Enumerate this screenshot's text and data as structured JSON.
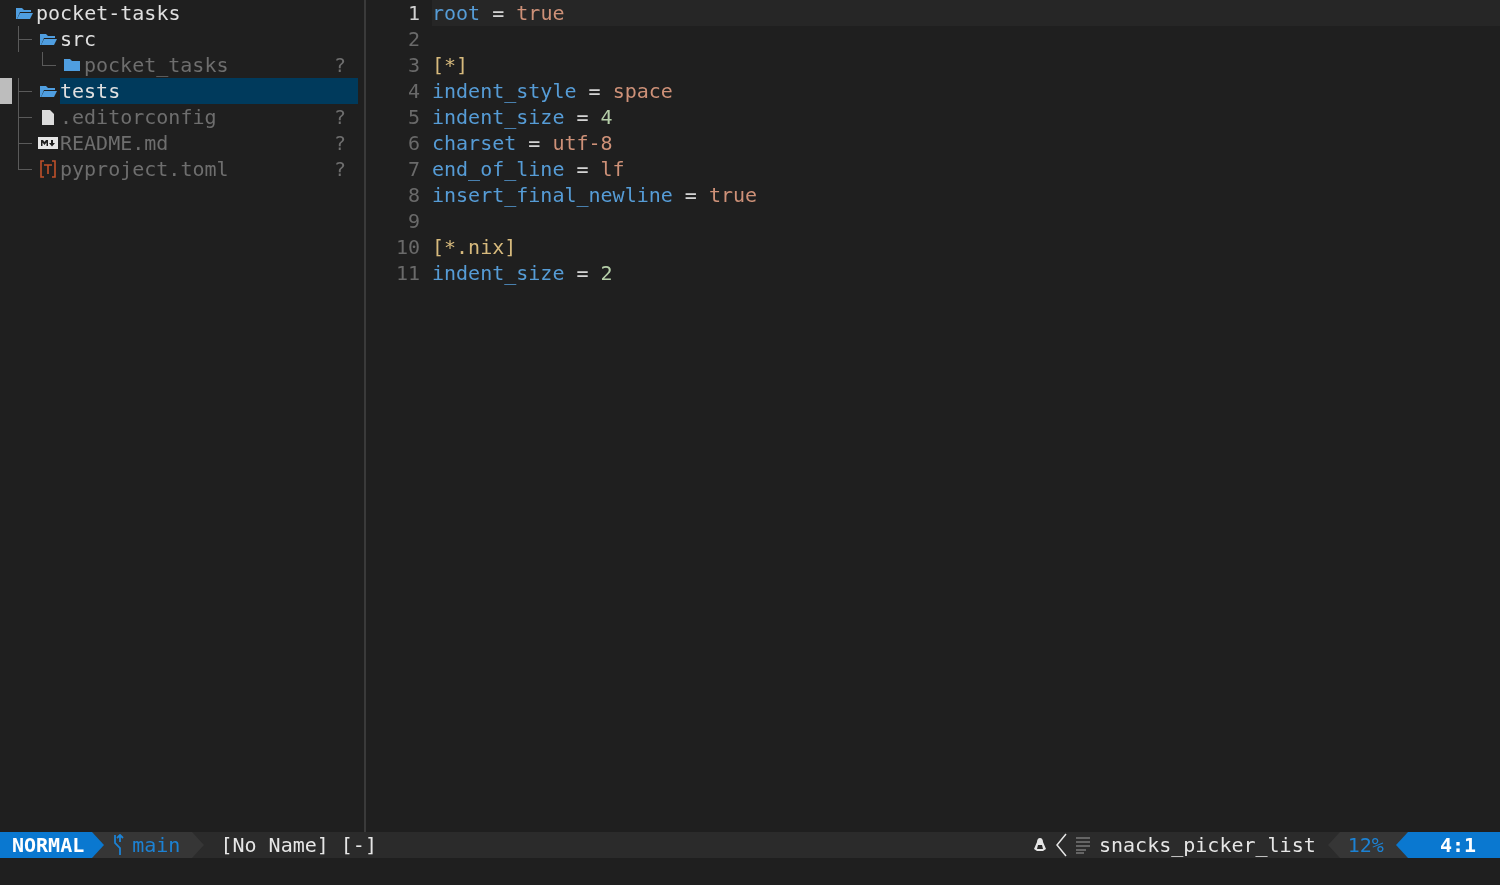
{
  "tree": [
    {
      "name": "pocket-tasks",
      "kind": "folder",
      "expanded": true,
      "dimmed": false,
      "selected": false,
      "children": [
        {
          "name": "src",
          "kind": "folder",
          "expanded": true,
          "dimmed": false,
          "selected": false,
          "children": [
            {
              "name": "pocket_tasks",
              "kind": "folder",
              "expanded": false,
              "dimmed": true,
              "selected": false,
              "status": "?"
            }
          ]
        },
        {
          "name": "tests",
          "kind": "folder",
          "expanded": true,
          "dimmed": false,
          "selected": true
        },
        {
          "name": ".editorconfig",
          "kind": "file",
          "dimmed": true,
          "selected": false,
          "status": "?"
        },
        {
          "name": "README.md",
          "kind": "markdown",
          "dimmed": true,
          "selected": false,
          "status": "?"
        },
        {
          "name": "pyproject.toml",
          "kind": "toml",
          "dimmed": true,
          "selected": false,
          "status": "?"
        }
      ]
    }
  ],
  "editor": {
    "lines": [
      {
        "number": "1",
        "current": true,
        "tokens": [
          {
            "kind": "key",
            "text": "root"
          },
          {
            "kind": "op",
            "text": " = "
          },
          {
            "kind": "string",
            "text": "true"
          }
        ]
      },
      {
        "number": "2",
        "current": false
      },
      {
        "number": "3",
        "current": false,
        "tokens": [
          {
            "kind": "section",
            "text": "[*]"
          }
        ]
      },
      {
        "number": "4",
        "current": false,
        "tokens": [
          {
            "kind": "key",
            "text": "indent_style"
          },
          {
            "kind": "op",
            "text": " = "
          },
          {
            "kind": "string",
            "text": "space"
          }
        ]
      },
      {
        "number": "5",
        "current": false,
        "tokens": [
          {
            "kind": "key",
            "text": "indent_size"
          },
          {
            "kind": "op",
            "text": " = "
          },
          {
            "kind": "number",
            "text": "4"
          }
        ]
      },
      {
        "number": "6",
        "current": false,
        "tokens": [
          {
            "kind": "key",
            "text": "charset"
          },
          {
            "kind": "op",
            "text": " = "
          },
          {
            "kind": "string",
            "text": "utf-8"
          }
        ]
      },
      {
        "number": "7",
        "current": false,
        "tokens": [
          {
            "kind": "key",
            "text": "end_of_line"
          },
          {
            "kind": "op",
            "text": " = "
          },
          {
            "kind": "string",
            "text": "lf"
          }
        ]
      },
      {
        "number": "8",
        "current": false,
        "tokens": [
          {
            "kind": "key",
            "text": "insert_final_newline"
          },
          {
            "kind": "op",
            "text": " = "
          },
          {
            "kind": "string",
            "text": "true"
          }
        ]
      },
      {
        "number": "9",
        "current": false
      },
      {
        "number": "10",
        "current": false,
        "tokens": [
          {
            "kind": "section",
            "text": "[*.nix]"
          }
        ]
      },
      {
        "number": "11",
        "current": false,
        "tokens": [
          {
            "kind": "key",
            "text": "indent_size"
          },
          {
            "kind": "op",
            "text": " = "
          },
          {
            "kind": "number",
            "text": "2"
          }
        ]
      }
    ]
  },
  "status_bar": {
    "mode": "NORMAL",
    "branch": "main",
    "buffer": "[No Name] [-]",
    "filetype": "snacks_picker_list",
    "progress": "12%",
    "position": "4:1"
  }
}
